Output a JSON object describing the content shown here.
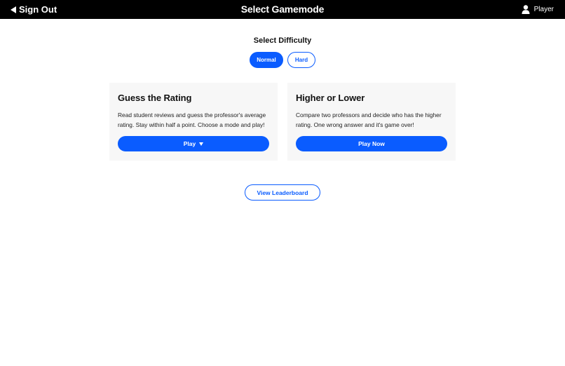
{
  "topbar": {
    "signout_label": "Sign Out",
    "title": "Select Gamemode",
    "user_label": "Player"
  },
  "difficulty": {
    "title": "Select Difficulty",
    "options": [
      {
        "label": "Normal",
        "selected": true
      },
      {
        "label": "Hard",
        "selected": false
      }
    ]
  },
  "cards": [
    {
      "title": "Guess the Rating",
      "description": "Read student reviews and guess the professor's average rating. Stay within half a point. Choose a mode and play!",
      "button_label": "Play"
    },
    {
      "title": "Higher or Lower",
      "description": "Compare two professors and decide who has the higher rating. One wrong answer and it's game over!",
      "button_label": "Play Now"
    }
  ],
  "leaderboard_label": "View Leaderboard",
  "colors": {
    "accent": "#0a5cff",
    "topbar": "#000000",
    "card_bg": "#f7f7f7"
  },
  "icons": {
    "back": "back-triangle-icon",
    "user": "user-icon",
    "dropdown": "caret-down-icon"
  }
}
